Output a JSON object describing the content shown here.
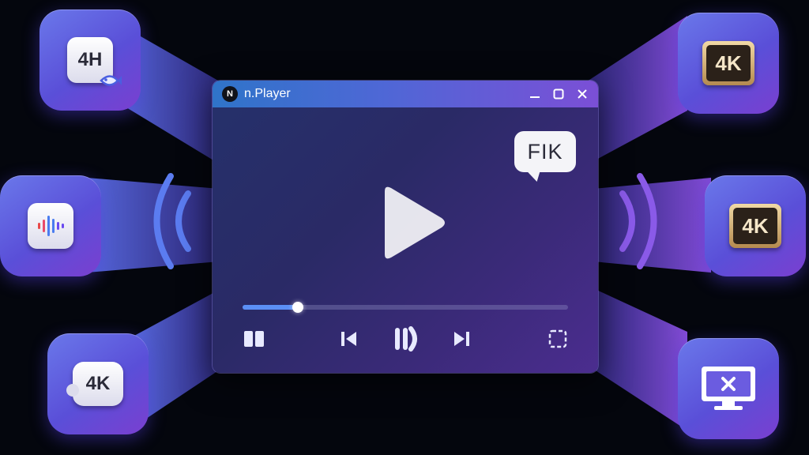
{
  "player": {
    "title": "n.Player",
    "logo_letter": "N",
    "subtitle_badge": "FIK",
    "progress": 0.17
  },
  "tiles": {
    "top_left": {
      "text": "4H",
      "icon": "4k-fish-icon"
    },
    "middle_left": {
      "icon": "audio-waveform-icon"
    },
    "bottom_left": {
      "text": "4K",
      "icon": "4k-puzzle-icon"
    },
    "top_right": {
      "text": "4K",
      "icon": "4k-badge-icon"
    },
    "middle_right": {
      "text": "4K",
      "icon": "4k-badge-icon"
    },
    "bottom_right": {
      "icon": "cast-screen-icon"
    }
  },
  "colors": {
    "background": "#04060d",
    "tile_gradient_start": "#6a78ea",
    "tile_gradient_end": "#7a3fd0",
    "titlebar_start": "#2f74c9",
    "titlebar_end": "#7b4fd6",
    "progress_fill": "#5b8ff5"
  }
}
